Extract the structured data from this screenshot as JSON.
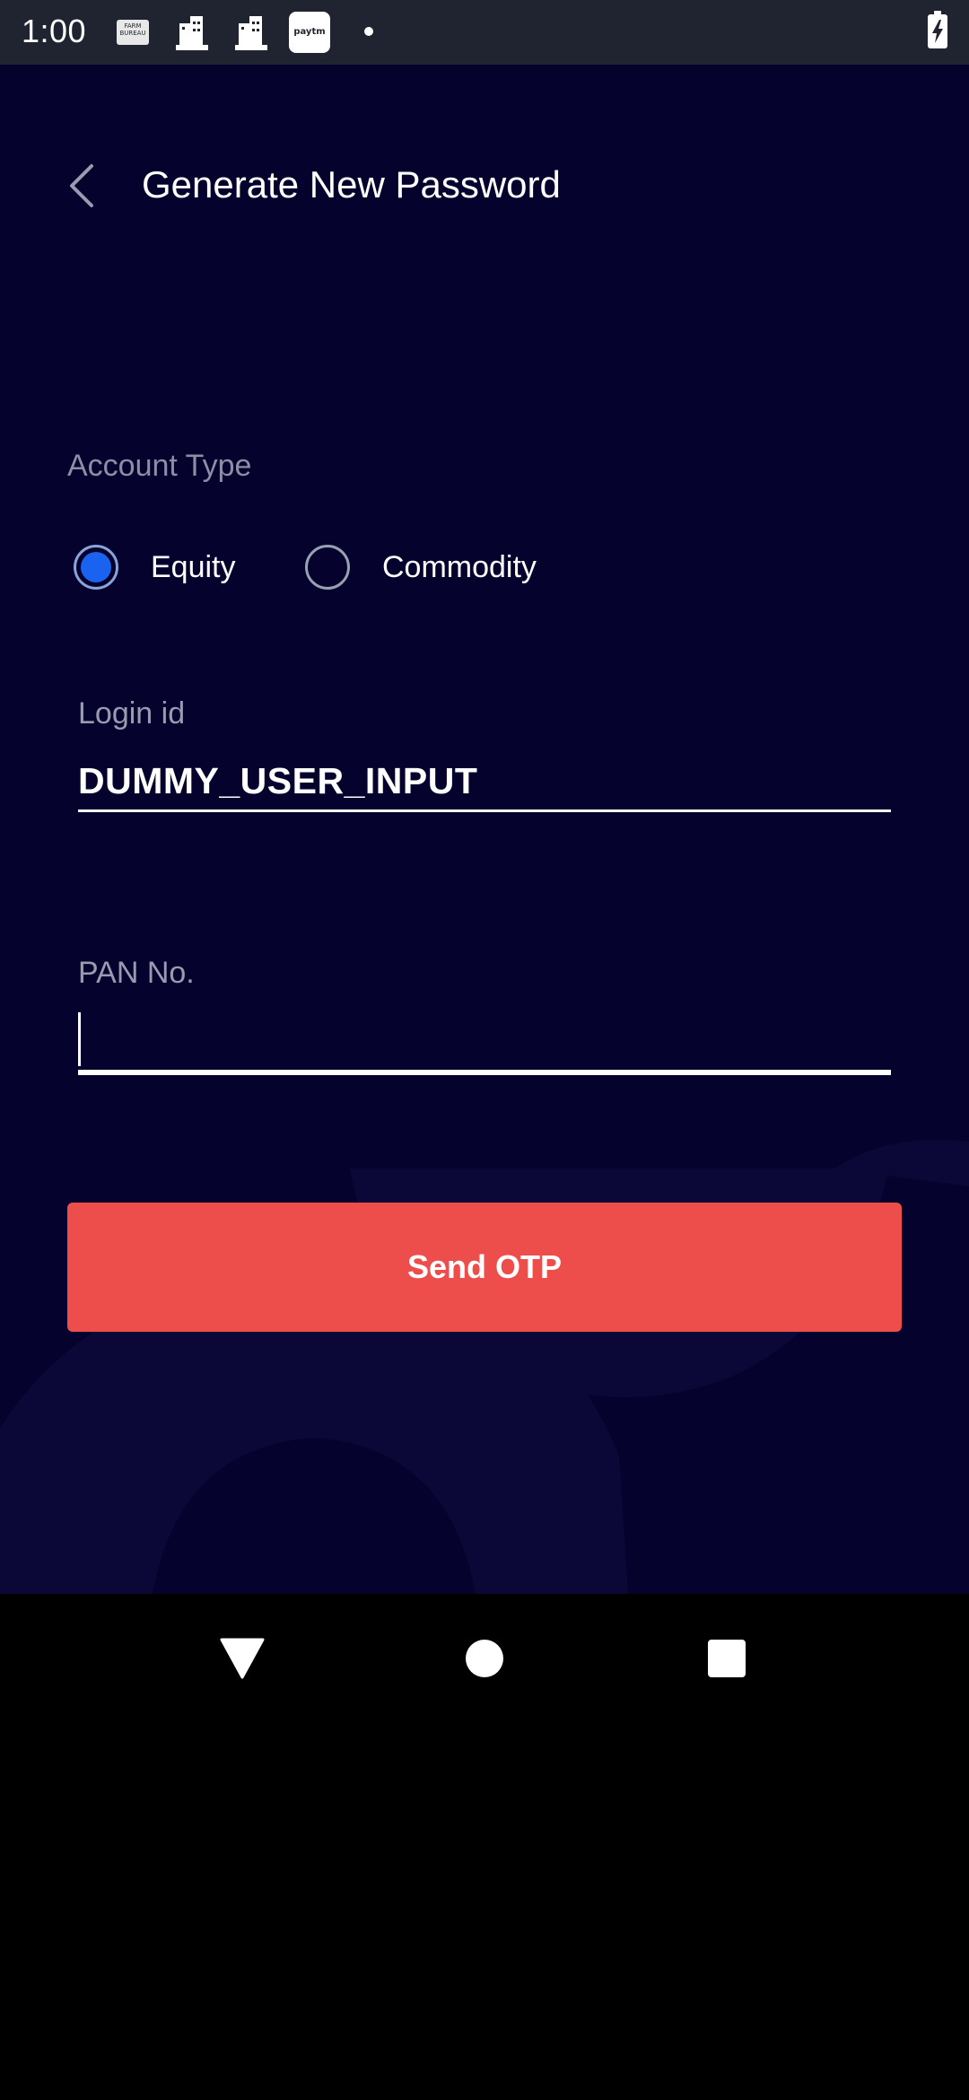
{
  "status_bar": {
    "time": "1:00",
    "notification_icons": [
      "farm-bureau-icon",
      "building-icon",
      "building-icon",
      "paytm-icon",
      "dot-icon"
    ],
    "fb_icon_text": "FARM BUREAU",
    "paytm_icon_text": "paytm",
    "battery": "charging"
  },
  "header": {
    "back_icon": "chevron-left-icon",
    "title": "Generate New Password"
  },
  "account_type": {
    "label": "Account Type",
    "options": [
      {
        "label": "Equity",
        "selected": true
      },
      {
        "label": "Commodity",
        "selected": false
      }
    ]
  },
  "login_field": {
    "label": "Login id",
    "value": "DUMMY_USER_INPUT"
  },
  "pan_field": {
    "label": "PAN No.",
    "value": ""
  },
  "send_button": {
    "label": "Send OTP"
  },
  "colors": {
    "background": "#05022d",
    "accent_button": "#ee4e4b",
    "radio_selected": "#1a63f0",
    "status_bar": "#1f2430"
  },
  "nav_bar": {
    "buttons": [
      "back-triangle-icon",
      "home-circle-icon",
      "recents-square-icon"
    ]
  }
}
